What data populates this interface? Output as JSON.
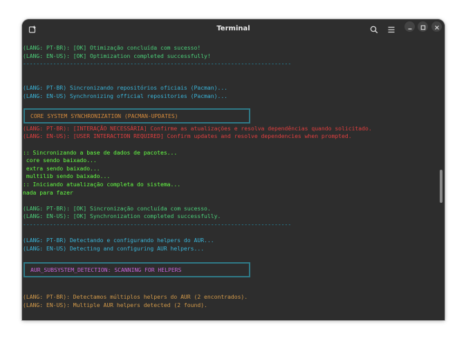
{
  "window": {
    "title": "Terminal"
  },
  "icons": {
    "new_tab": "new-tab-icon",
    "search": "search-icon",
    "menu": "hamburger-menu-icon",
    "minimize": "minimize-icon",
    "maximize": "maximize-icon",
    "close": "close-icon"
  },
  "colors": {
    "background": "#2d2d2d",
    "green": "#4cd07a",
    "cyan": "#3ab4d8",
    "red": "#e23f3f",
    "lime": "#66ff44",
    "orange": "#d58a3c",
    "magenta": "#c862d8",
    "box_border": "#2f7a88"
  },
  "terminal": {
    "lines": {
      "l1": "(LANG: PT-BR): [OK] Otimização concluída com sucesso!",
      "l2": "(LANG: EN-US): [OK] Optimization completed successfully!",
      "sep1": "--------------------------------------------------------------------------------",
      "l3": "(LANG: PT-BR) Sincronizando repositórios oficiais (Pacman)...",
      "l4": "(LANG: EN-US) Synchronizing official repositories (Pacman)...",
      "box1": "CORE SYSTEM SYNCHRONIZATION (PACMAN-UPDATES)",
      "l5": "(LANG: PT-BR): [INTERAÇÃO NECESSÁRIA] Confirme as atualizações e resolva dependências quando solicitado.",
      "l6": "(LANG: EN-US): [USER INTERACTION REQUIRED] Confirm updates and resolve dependencies when prompted.",
      "l7": ":: Sincronizando a base de dados de pacotes...",
      "l8": " core sendo baixado...",
      "l9": " extra sendo baixado...",
      "l10": " multilib sendo baixado...",
      "l11": ":: Iniciando atualização completa do sistema...",
      "l12": "nada para fazer",
      "l13": "(LANG: PT-BR): [OK] Sincronização concluída com sucesso.",
      "l14": "(LANG: EN-US): [OK] Synchronization completed successfully.",
      "sep2": "--------------------------------------------------------------------------------",
      "l15": "(LANG: PT-BR) Detectando e configurando helpers do AUR...",
      "l16": "(LANG: EN-US) Detecting and configuring AUR helpers...",
      "box2": "AUR_SUBSYSTEM_DETECTION: SCANNING FOR HELPERS",
      "l17": "(LANG: PT-BR): Detectamos múltiplos helpers do AUR (2 encontrados).",
      "l18": "(LANG: EN-US): Multiple AUR helpers detected (2 found)."
    }
  }
}
